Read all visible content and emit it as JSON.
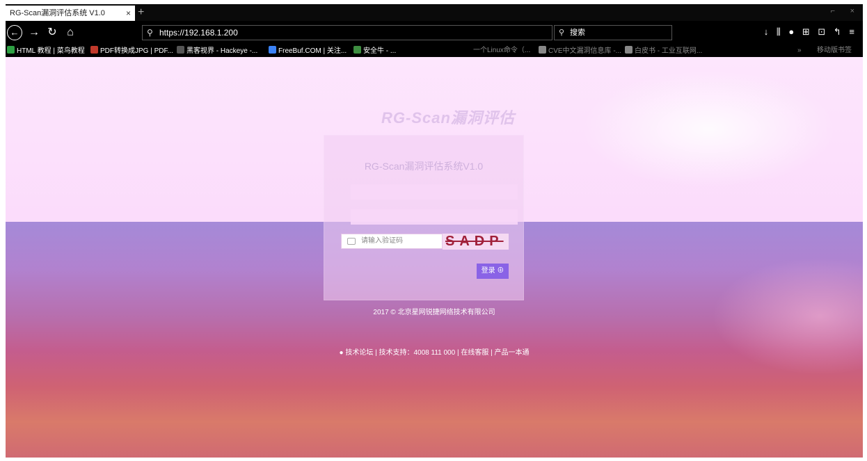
{
  "browser": {
    "tab_title": "RG-Scan漏洞评估系统 V1.0",
    "tab_close": "×",
    "new_tab": "+",
    "win_min": "⌐",
    "win_close": "×",
    "url": "https://192.168.1.200",
    "search_placeholder": "搜索",
    "toolbar_icons": "↓ ⫼ ● ⊞ ⊡ ↰ ≡"
  },
  "bookmarks": [
    {
      "label": "HTML 教程 | 菜鸟教程",
      "color": "#2ea043"
    },
    {
      "label": "PDF转换成JPG | PDF...",
      "color": "#c0392b"
    },
    {
      "label": "黑客视界 - Hackeye -...",
      "color": "#555"
    },
    {
      "label": "FreeBuf.COM | 关注...",
      "color": "#3b82f6"
    },
    {
      "label": "安全牛 - ...",
      "color": "#3e8e41"
    },
    {
      "label": "一个Linux命令（...",
      "color": "#888"
    },
    {
      "label": "CVE中文漏洞信息库 -...",
      "color": "#888"
    },
    {
      "label": "白皮书 - 工业互联网...",
      "color": "#888"
    },
    {
      "label": "»",
      "color": "#888"
    },
    {
      "label": "移动版书签",
      "color": "#888"
    }
  ],
  "login": {
    "logo_text": "RG-Scan漏洞评估",
    "title": "RG-Scan漏洞评估系统V1.0",
    "captcha_placeholder": "请输入验证码",
    "captcha_text": "SADP",
    "login_label": "登录 ⊕"
  },
  "footer": {
    "copyright": "2017 © 北京星网锐捷网络技术有限公司",
    "support": "技术论坛 | 技术支持：4008 111 000 | 在线客服 | 产品一本通"
  }
}
